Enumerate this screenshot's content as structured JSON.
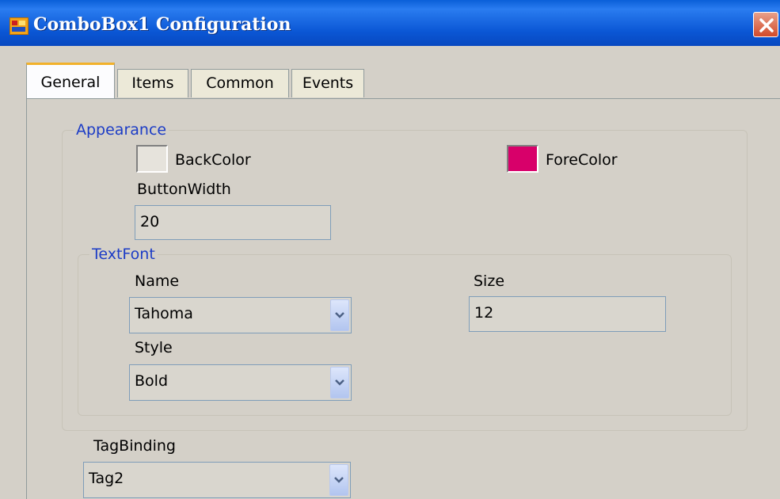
{
  "window": {
    "title": "ComboBox1 Configuration"
  },
  "tabs": [
    {
      "label": "General",
      "active": true
    },
    {
      "label": "Items",
      "active": false
    },
    {
      "label": "Common",
      "active": false
    },
    {
      "label": "Events",
      "active": false
    }
  ],
  "appearance": {
    "legend": "Appearance",
    "backcolor": {
      "label": "BackColor",
      "color": "#e6e3dc"
    },
    "forecolor": {
      "label": "ForeColor",
      "color": "#d8006a"
    },
    "button_width": {
      "label": "ButtonWidth",
      "value": "20"
    }
  },
  "textfont": {
    "legend": "TextFont",
    "name": {
      "label": "Name",
      "value": "Tahoma"
    },
    "size": {
      "label": "Size",
      "value": "12"
    },
    "style": {
      "label": "Style",
      "value": "Bold"
    }
  },
  "tag_binding": {
    "label": "TagBinding",
    "value": "Tag2"
  },
  "icons": {
    "app": "app-window-icon",
    "close": "close-icon",
    "dropdown": "chevron-down-icon"
  }
}
